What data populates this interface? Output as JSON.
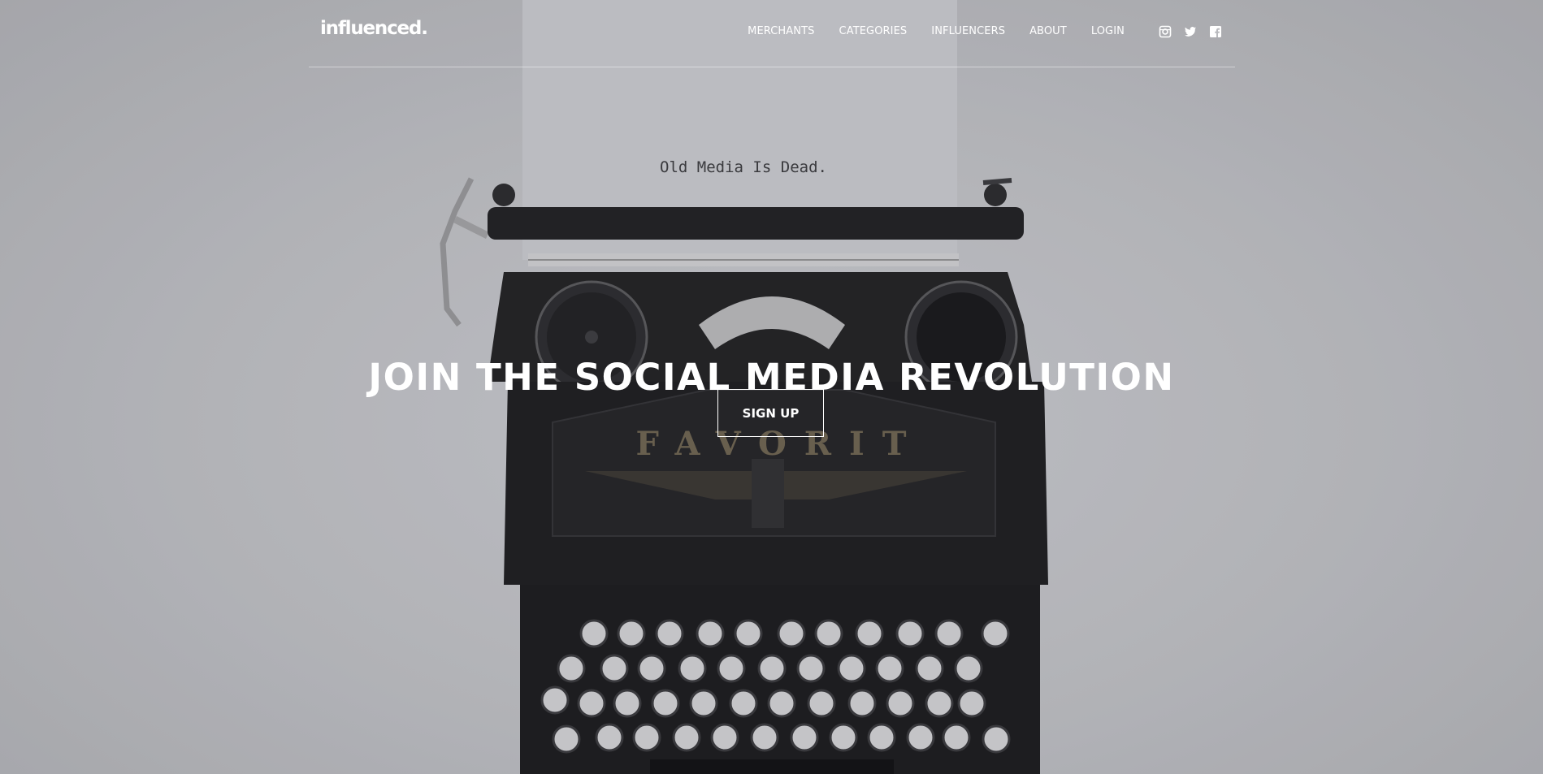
{
  "brand": {
    "logo_text": "influenced."
  },
  "nav": {
    "items": [
      {
        "label": "MERCHANTS"
      },
      {
        "label": "CATEGORIES"
      },
      {
        "label": "INFLUENCERS"
      },
      {
        "label": "ABOUT"
      },
      {
        "label": "LOGIN"
      }
    ],
    "social": [
      "instagram-icon",
      "twitter-icon",
      "facebook-icon"
    ]
  },
  "hero": {
    "paper_text": "Old Media Is Dead.",
    "typewriter_brand": "FAVORIT",
    "headline": "JOIN THE SOCIAL MEDIA REVOLUTION",
    "cta_label": "SIGN UP"
  },
  "colors": {
    "text": "#ffffff",
    "background": "#c4c5c9",
    "typewriter": "#1c1c1e"
  }
}
